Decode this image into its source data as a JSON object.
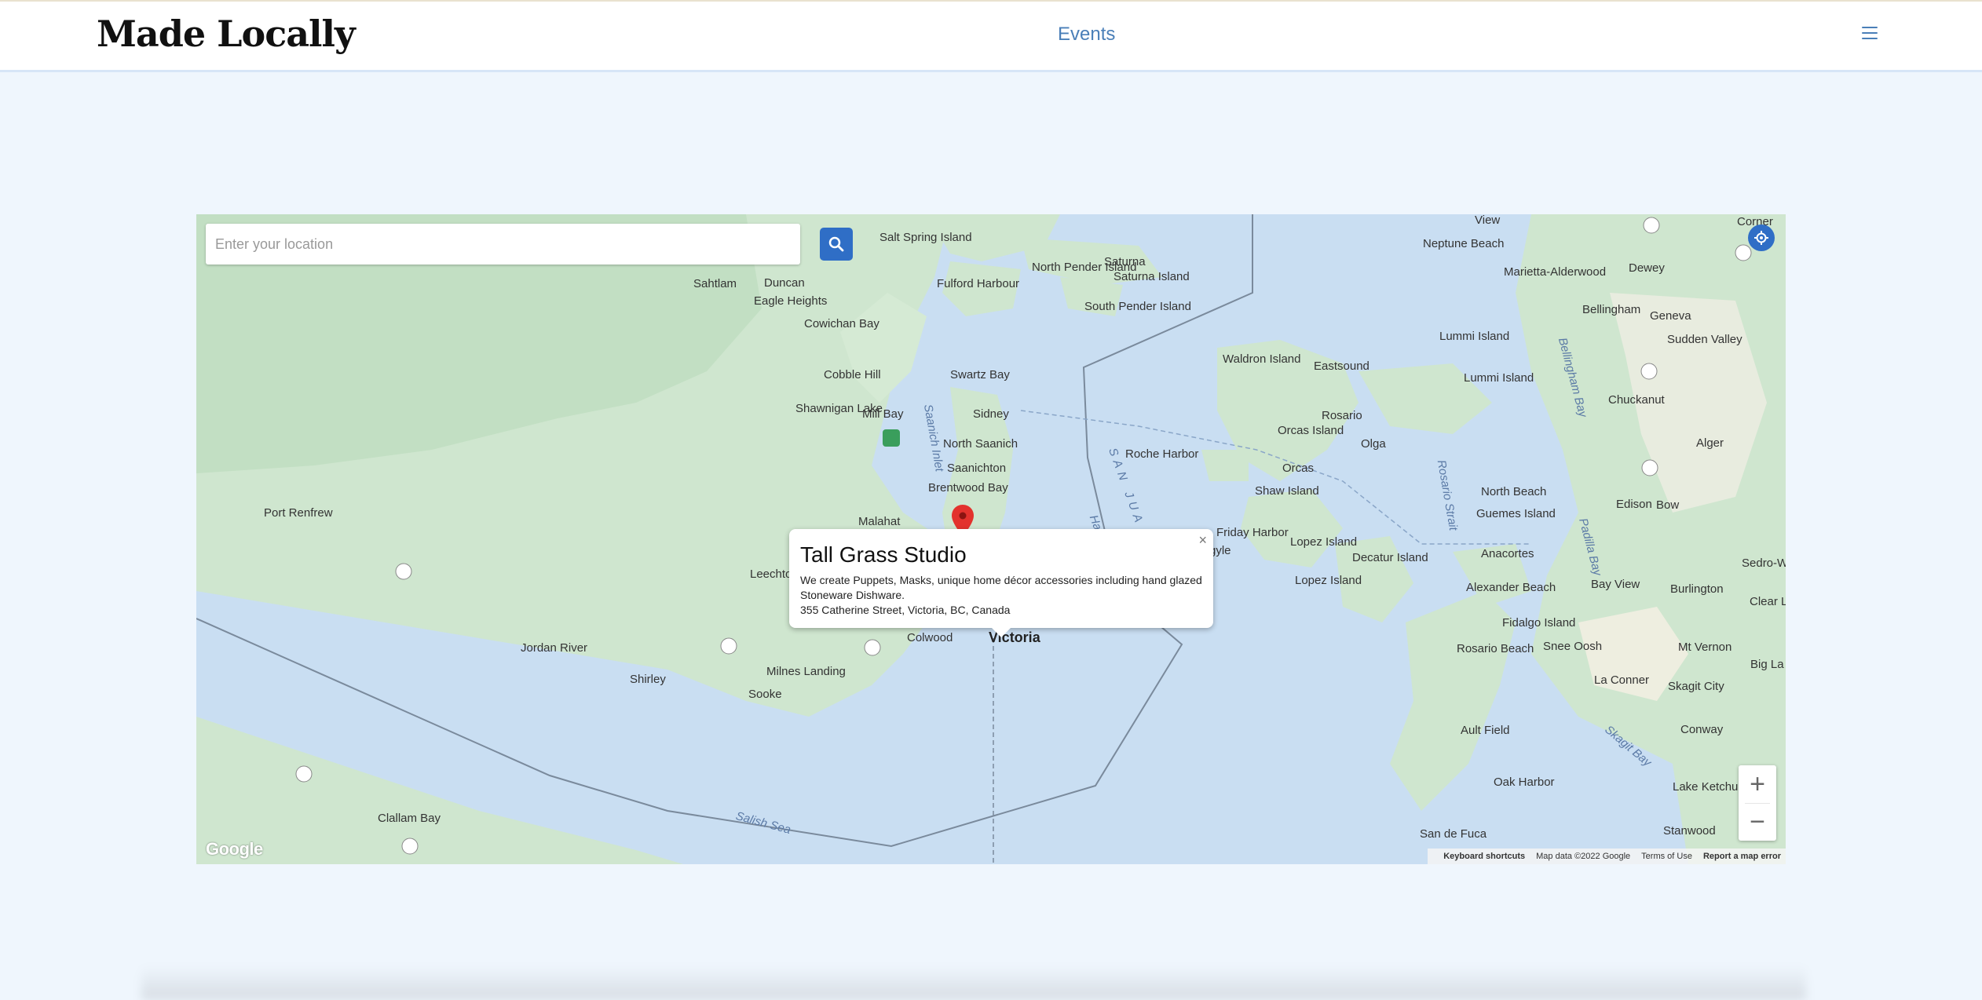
{
  "header": {
    "brand": "Made Locally",
    "nav_events": "Events"
  },
  "search": {
    "placeholder": "Enter your location"
  },
  "map": {
    "labels": {
      "salt_spring": "Salt Spring Island",
      "sahtlam": "Sahtlam",
      "duncan": "Duncan",
      "eagle_heights": "Eagle Heights",
      "fulford": "Fulford Harbour",
      "north_pender": "North Pender Island",
      "saturna": "Saturna",
      "saturna_island": "Saturna Island",
      "south_pender": "South Pender Island",
      "cowichan_bay": "Cowichan Bay",
      "cobble_hill": "Cobble Hill",
      "swartz_bay": "Swartz Bay",
      "shawnigan": "Shawnigan Lake",
      "mill_bay": "Mill Bay",
      "sidney": "Sidney",
      "north_saanich": "North Saanich",
      "saanichton": "Saanichton",
      "brentwood": "Brentwood Bay",
      "malahat": "Malahat",
      "port_renfrew": "Port Renfrew",
      "leechtown": "Leechtown",
      "jordan_river": "Jordan River",
      "shirley": "Shirley",
      "sooke": "Sooke",
      "milnes": "Milnes Landing",
      "colwood": "Colwood",
      "victoria": "Victoria",
      "clallam_bay": "Clallam Bay",
      "waldron": "Waldron Island",
      "eastsound": "Eastsound",
      "roche_harbor": "Roche Harbor",
      "rosario": "Rosario",
      "orcas_island": "Orcas Island",
      "olga": "Olga",
      "orcas": "Orcas",
      "shaw_island": "Shaw Island",
      "friday_harbor": "Friday Harbor",
      "argyle": "Argyle",
      "lopez_island": "Lopez Island",
      "lopez_island_2": "Lopez Island",
      "decatur": "Decatur Island",
      "neptune_beach": "Neptune Beach",
      "marietta": "Marietta-Alderwood",
      "dewey": "Dewey",
      "bellingham": "Bellingham",
      "geneva": "Geneva",
      "sudden_valley": "Sudden Valley",
      "lummi_island": "Lummi Island",
      "lummi_island_2": "Lummi Island",
      "chuckanut": "Chuckanut",
      "alger": "Alger",
      "north_beach": "North Beach",
      "guemes": "Guemes Island",
      "edison": "Edison",
      "bow": "Bow",
      "anacortes": "Anacortes",
      "bay_view": "Bay View",
      "burlington": "Burlington",
      "sedro": "Sedro-W",
      "clear": "Clear L",
      "alexander": "Alexander Beach",
      "fidalgo": "Fidalgo Island",
      "rosario_beach": "Rosario Beach",
      "snee_oosh": "Snee Oosh",
      "mt_vernon": "Mt Vernon",
      "big_lake": "Big La",
      "la_conner": "La Conner",
      "skagit_city": "Skagit City",
      "conway": "Conway",
      "ault_field": "Ault Field",
      "oak_harbor": "Oak Harbor",
      "lake_ketchum": "Lake Ketchum",
      "san_de_fuca": "San de Fuca",
      "stanwood": "Stanwood",
      "corner": "Corner",
      "view": "View",
      "saanich_inlet": "Saanich Inlet",
      "rosario_strait": "Rosario Strait",
      "padilla_bay": "Padilla Bay",
      "bellingham_bay": "Bellingham Bay",
      "skagit_bay": "Skagit Bay",
      "salish_sea": "Salish Sea",
      "haro": "SAN JUA",
      "haro2": "Ha"
    },
    "footer": {
      "shortcuts": "Keyboard shortcuts",
      "data": "Map data ©2022 Google",
      "terms": "Terms of Use",
      "report": "Report a map error"
    },
    "google": "Google",
    "zoom_in": "+",
    "zoom_out": "−"
  },
  "infowindow": {
    "title": "Tall Grass Studio",
    "description": "We create Puppets, Masks, unique home décor accessories including hand glazed Stoneware Dishware.",
    "address": "355 Catherine Street, Victoria, BC, Canada",
    "close": "×"
  },
  "colors": {
    "accent": "#2f6ec6",
    "water": "#c9def2",
    "land": "#cfe6cf",
    "pin": "#e3322d",
    "nav": "#4a7fb8"
  }
}
